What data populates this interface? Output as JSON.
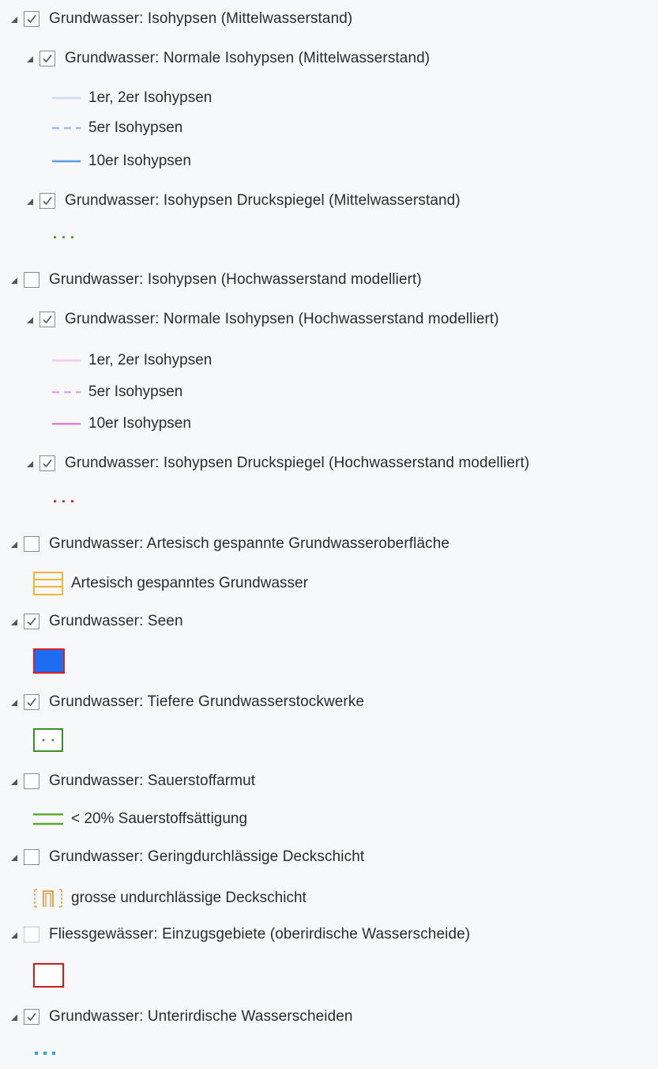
{
  "layers": [
    {
      "name": "Grundwasser: Isohypsen (Mittelwasserstand)",
      "checked": true
    },
    {
      "name": "Grundwasser: Normale Isohypsen (Mittelwasserstand)",
      "checked": true
    },
    {
      "legend": "1er, 2er Isohypsen"
    },
    {
      "legend": "5er Isohypsen"
    },
    {
      "legend": "10er Isohypsen"
    },
    {
      "name": "Grundwasser: Isohypsen Druckspiegel (Mittelwasserstand)",
      "checked": true
    },
    {
      "name": "Grundwasser: Isohypsen (Hochwasserstand modelliert)",
      "checked": false
    },
    {
      "name": "Grundwasser: Normale Isohypsen (Hochwasserstand modelliert)",
      "checked": true
    },
    {
      "legend": "1er, 2er Isohypsen"
    },
    {
      "legend": "5er Isohypsen"
    },
    {
      "legend": "10er Isohypsen"
    },
    {
      "name": "Grundwasser: Isohypsen Druckspiegel (Hochwasserstand modelliert)",
      "checked": true
    },
    {
      "name": "Grundwasser: Artesisch gespannte Grundwasseroberfläche",
      "checked": false
    },
    {
      "legend": "Artesisch gespanntes Grundwasser"
    },
    {
      "name": "Grundwasser: Seen",
      "checked": true
    },
    {
      "name": "Grundwasser: Tiefere Grundwasserstockwerke",
      "checked": true
    },
    {
      "name": "Grundwasser: Sauerstoffarmut",
      "checked": false
    },
    {
      "legend": "< 20% Sauerstoffsättigung"
    },
    {
      "name": "Grundwasser: Geringdurchlässige Deckschicht",
      "checked": false
    },
    {
      "legend": "grosse undurchlässige Deckschicht"
    },
    {
      "name": "Fliessgewässer: Einzugsgebiete (oberirdische Wasserscheide)",
      "checked": false,
      "dimmed": true
    },
    {
      "name": "Grundwasser: Unterirdische Wasserscheiden",
      "checked": true
    }
  ],
  "colors": {
    "blue_light": "#c9dcf3",
    "blue_mid": "#9cc0ea",
    "blue_dark": "#5f9be0",
    "pink_light": "#f2c8ef",
    "pink_mid": "#e6a3e2",
    "pink_dark": "#d77fd4",
    "green_dots": "#5a9a2a",
    "red_dots": "#c0392b",
    "orange": "#f2b53a",
    "lake_fill": "#1e6cf0",
    "lake_border": "#e02020",
    "green_box": "#3d8f2a",
    "sauerstoff_green": "#5cab2d",
    "deck_orange": "#e6a04e",
    "einzug_red": "#c42020",
    "cyan_dots": "#2aa8e0"
  }
}
